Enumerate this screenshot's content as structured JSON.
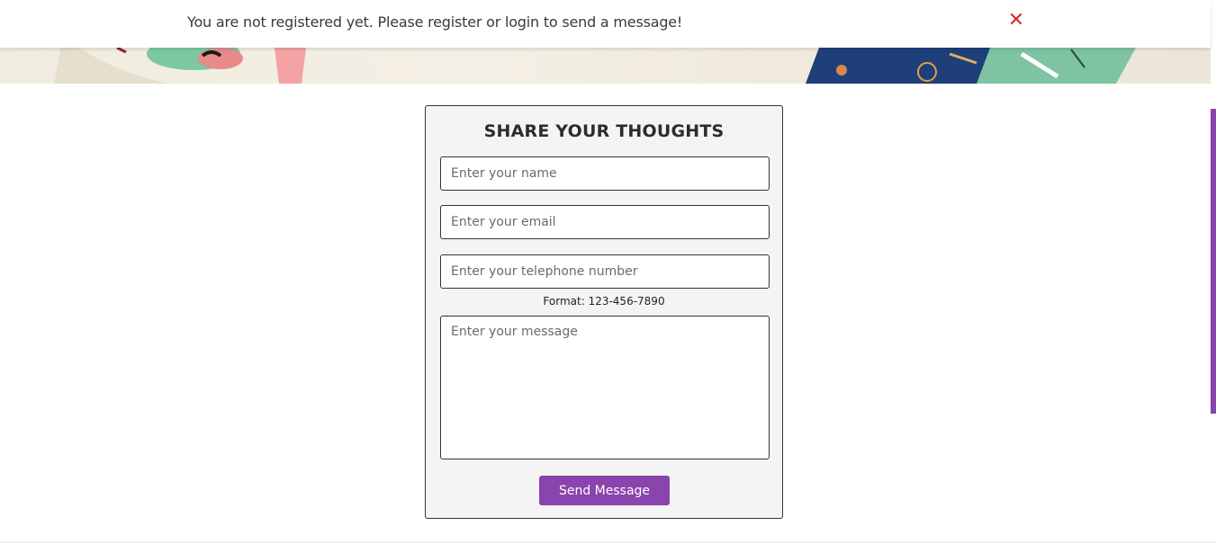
{
  "notice": {
    "text": "You are not registered yet. Please register or login to send a message!",
    "close_glyph": "✕",
    "close_icon": "close-icon",
    "color": "#d32f2f"
  },
  "form": {
    "title": "SHARE YOUR THOUGHTS",
    "name_placeholder": "Enter your name",
    "email_placeholder": "Enter your email",
    "phone_placeholder": "Enter your telephone number",
    "phone_hint": "Format: 123-456-7890",
    "message_placeholder": "Enter your message",
    "send_label": "Send Message"
  },
  "colors": {
    "accent": "#8a44ad",
    "card_bg": "#f4f4f4",
    "border": "#333333"
  }
}
